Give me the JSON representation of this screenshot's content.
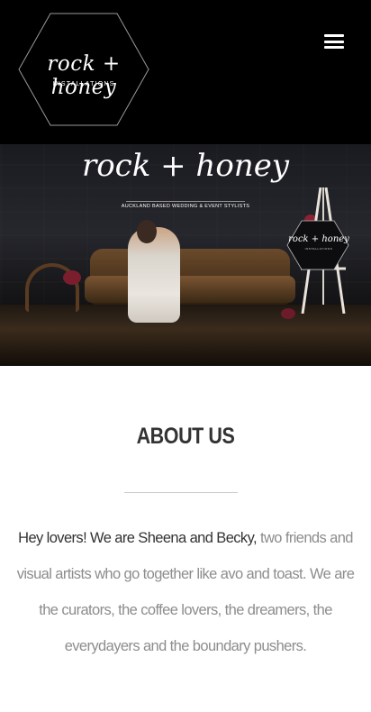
{
  "header": {
    "logo": {
      "script": "rock + honey",
      "subtitle": "INSTALLATIONS"
    },
    "menu_icon": "bars-icon"
  },
  "hero": {
    "title": "rock + honey",
    "tagline": "AUCKLAND BASED WEDDING & EVENT STYLISTS",
    "sign_script": "rock + honey",
    "sign_subtitle": "INSTALLATIONS"
  },
  "about": {
    "title": "ABOUT US",
    "lead": "Hey lovers! We are Sheena and Becky,",
    "body": " two friends and visual artists who go together like avo and toast. We are the curators, the coffee lovers, the dreamers, the everydayers and the boundary pushers."
  },
  "colors": {
    "header_bg": "#000000",
    "heading": "#333333",
    "body_text": "#8d8d8d"
  }
}
